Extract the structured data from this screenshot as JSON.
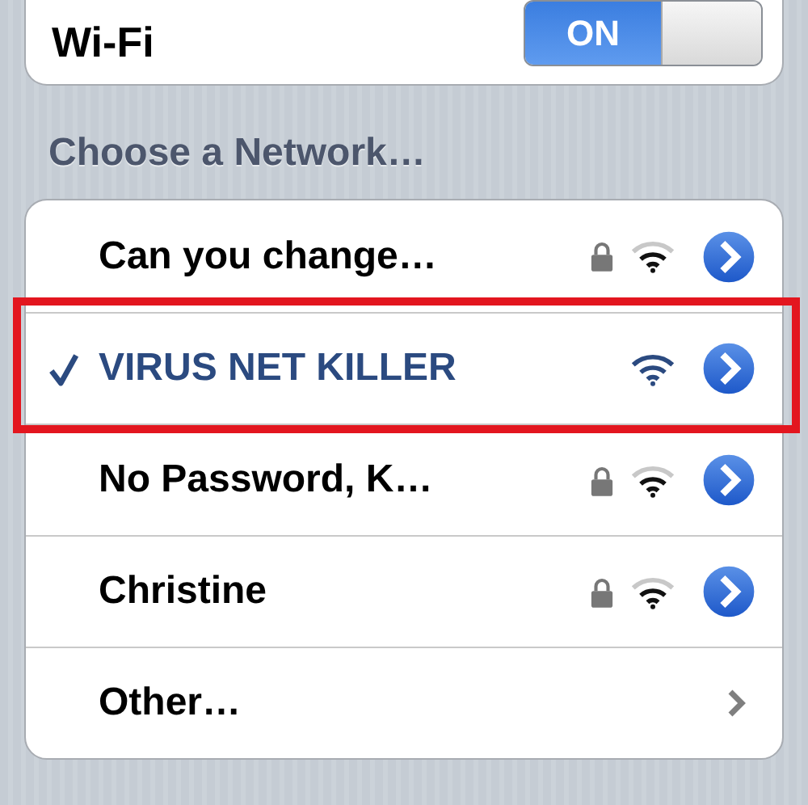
{
  "wifi": {
    "label": "Wi-Fi",
    "on": true,
    "toggle_text": "ON"
  },
  "section_title": "Choose a Network…",
  "networks": [
    {
      "kind": "network",
      "name": "Can you change…",
      "selected": false,
      "secured": true,
      "highlighted": false
    },
    {
      "kind": "network",
      "name": "VIRUS NET KILLER",
      "selected": true,
      "secured": false,
      "highlighted": true
    },
    {
      "kind": "network",
      "name": "No Password, K…",
      "selected": false,
      "secured": true,
      "highlighted": false
    },
    {
      "kind": "network",
      "name": "Christine",
      "selected": false,
      "secured": true,
      "highlighted": false
    },
    {
      "kind": "other",
      "name": "Other…",
      "selected": false,
      "highlighted": false
    }
  ]
}
